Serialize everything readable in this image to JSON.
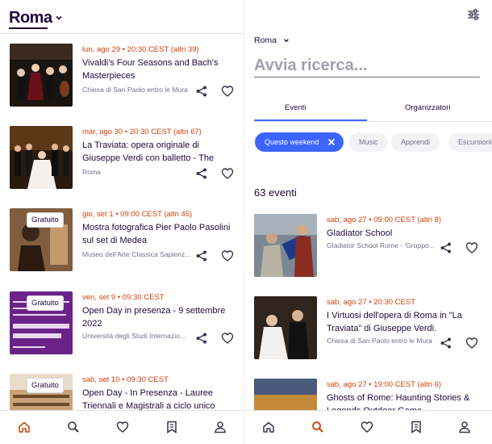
{
  "left": {
    "city": "Roma",
    "events": [
      {
        "date": "lun, ago 29 • 20:30 CEST",
        "extra": " (altri 39)",
        "title": "Vivaldi's Four Seasons and Bach's Masterpieces",
        "location": "Chiesa di San Paolo entro le Mura",
        "badge": ""
      },
      {
        "date": "mar, ago 30 • 20:30 CEST",
        "extra": " (altri 67)",
        "title": "La Traviata: opera originale di Giuseppe Verdi con balletto - The original opera ...",
        "location": "Roma",
        "badge": ""
      },
      {
        "date": "gio, set 1 • 09:00 CEST",
        "extra": " (altri 45)",
        "title": "Mostra fotografica Pier Paolo Pasolini sul set di Medea",
        "location": "Museo dell'Arte Classica Sapienz...",
        "badge": "Gratuito"
      },
      {
        "date": "ven, set 9 • 09:30 CEST",
        "extra": "",
        "title": "Open Day in presenza - 9 settembre 2022",
        "location": "Università degli Studi Internazio...",
        "badge": "Gratuito"
      },
      {
        "date": "sab, set 10 • 09:30 CEST",
        "extra": "",
        "title": "Open Day - In Presenza - Lauree Triennali e Magistrali a ciclo unico",
        "location": "",
        "badge": "Gratuito"
      }
    ]
  },
  "right": {
    "city": "Roma",
    "search_placeholder": "Avvia ricerca...",
    "tabs": [
      "Eventi",
      "Organizzatori"
    ],
    "chips": [
      {
        "label": "Questo weekend",
        "active": true
      },
      {
        "label": "Music",
        "active": false
      },
      {
        "label": "Apprendi",
        "active": false
      },
      {
        "label": "Escursioni",
        "active": false
      }
    ],
    "count": "63 eventi",
    "events": [
      {
        "date": "sab, ago 27 • 09:00 CEST",
        "extra": " (altri 8)",
        "title": "Gladiator School",
        "location": "Gladiator School Rome - 'Gruppo..."
      },
      {
        "date": "sab, ago 27 • 20:30 CEST",
        "extra": "",
        "title": "I  Virtuosi dell'opera di Roma in \"La Traviata\" di Giuseppe Verdi.",
        "location": "Chiesa di San Paolo entro le Mura"
      },
      {
        "date": "sab, ago 27 • 19:00 CEST",
        "extra": " (altri 6)",
        "title": "Ghosts of Rome: Haunting Stories & Legends Outdoor Game",
        "location": ""
      }
    ]
  },
  "nav": [
    "home-icon",
    "search-icon",
    "heart-icon",
    "tickets-icon",
    "profile-icon"
  ],
  "colors": {
    "accent": "#d1410c",
    "primary": "#3d64ff",
    "text": "#1e0a3c",
    "muted": "#6f7287"
  }
}
